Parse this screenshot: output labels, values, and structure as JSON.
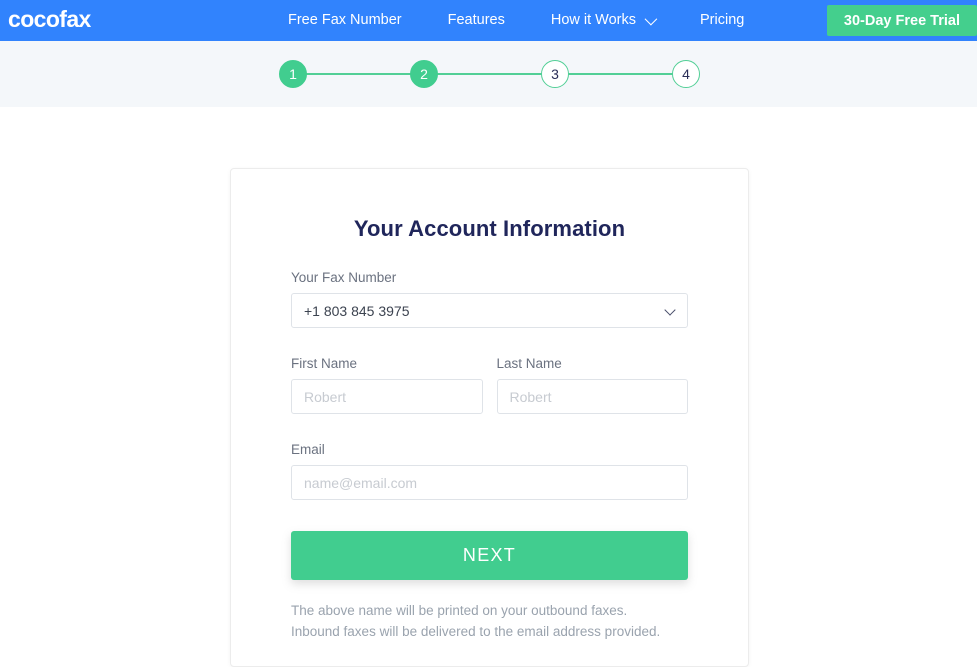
{
  "navbar": {
    "logo_text": "cocofax",
    "brand_blue": "#3183fd",
    "links": [
      {
        "label": "Free Fax Number",
        "has_dropdown": false
      },
      {
        "label": "Features",
        "has_dropdown": false
      },
      {
        "label": "How it Works",
        "has_dropdown": true
      },
      {
        "label": "Pricing",
        "has_dropdown": false
      }
    ],
    "cta_label": "30-Day Free Trial",
    "cta_color": "#44cf8d"
  },
  "stepper": {
    "accent_green": "#41cd8f",
    "band_background": "#f4f7fa",
    "current_step": 2,
    "steps": [
      {
        "number": "1",
        "state": "done"
      },
      {
        "number": "2",
        "state": "done"
      },
      {
        "number": "3",
        "state": "todo"
      },
      {
        "number": "4",
        "state": "todo"
      }
    ]
  },
  "card": {
    "title": "Your Account Information",
    "fax_number": {
      "label": "Your Fax Number",
      "selected_value": "+1 803 845 3975",
      "options": [
        "+1 803 845 3975"
      ]
    },
    "first_name": {
      "label": "First Name",
      "value": "",
      "placeholder": "Robert"
    },
    "last_name": {
      "label": "Last Name",
      "value": "",
      "placeholder": "Robert"
    },
    "email": {
      "label": "Email",
      "value": "",
      "placeholder": "name@email.com"
    },
    "submit_label": "NEXT",
    "note_line1": "The above name will be printed on your outbound faxes.",
    "note_line2": "Inbound faxes will be delivered to the email address provided."
  }
}
